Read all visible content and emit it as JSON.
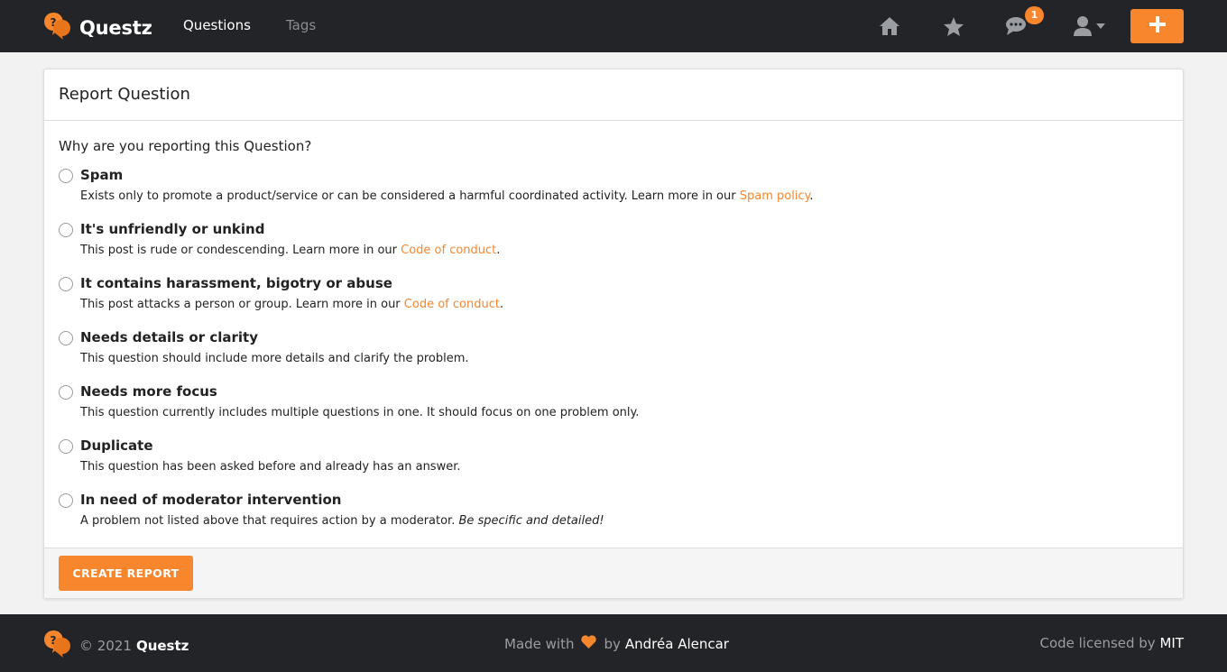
{
  "navbar": {
    "brand": "Questz",
    "links": [
      {
        "label": "Questions"
      },
      {
        "label": "Tags"
      }
    ],
    "notification_count": "1",
    "icons": [
      "home-icon",
      "star-icon",
      "comments-icon",
      "user-icon",
      "caret-down-icon",
      "plus-icon"
    ]
  },
  "card": {
    "title": "Report Question",
    "prompt": "Why are you reporting this Question?",
    "options": [
      {
        "title": "Spam",
        "desc": "Exists only to promote a product/service or can be considered a harmful coordinated activity. Learn more in our ",
        "link": "Spam policy",
        "after": "."
      },
      {
        "title": "It's unfriendly or unkind",
        "desc": "This post is rude or condescending. Learn more in our ",
        "link": "Code of conduct",
        "after": "."
      },
      {
        "title": "It contains harassment, bigotry or abuse",
        "desc": "This post attacks a person or group. Learn more in our ",
        "link": "Code of conduct",
        "after": "."
      },
      {
        "title": "Needs details or clarity",
        "desc": "This question should include more details and clarify the problem."
      },
      {
        "title": "Needs more focus",
        "desc": "This question currently includes multiple questions in one. It should focus on one problem only."
      },
      {
        "title": "Duplicate",
        "desc": "This question has been asked before and already has an answer."
      },
      {
        "title": "In need of moderator intervention",
        "desc": "A problem not listed above that requires action by a moderator. ",
        "emphasis": "Be specific and detailed!"
      }
    ],
    "submit_label": "CREATE REPORT"
  },
  "footer": {
    "copyright": "© 2021",
    "brand": "Questz",
    "made_with": "Made with",
    "by": "by",
    "author": "Andréa Alencar",
    "license_text": "Code licensed by",
    "license": "MIT"
  },
  "colors": {
    "accent": "#f7862c",
    "navbar_bg": "#222428"
  }
}
